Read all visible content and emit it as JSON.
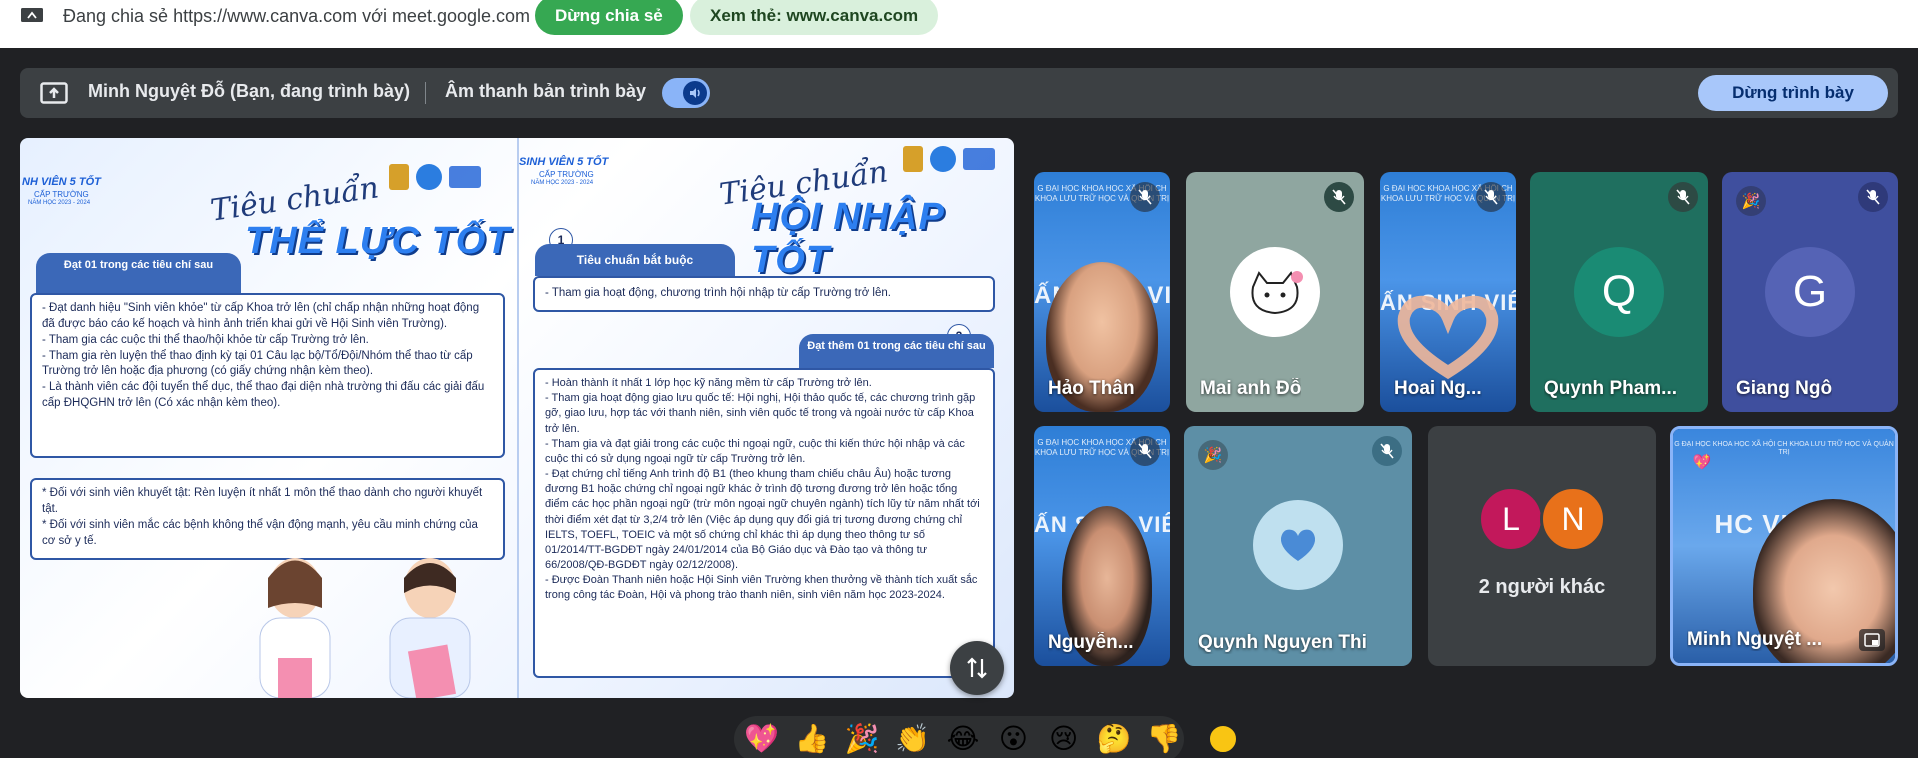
{
  "share_bar": {
    "text": "Đang chia sẻ https://www.canva.com với meet.google.com",
    "stop_share_label": "Dừng chia sẻ",
    "view_tab_label": "Xem thẻ: www.canva.com"
  },
  "presenter_bar": {
    "presenter": "Minh Nguyệt Đỗ (Bạn, đang trình bày)",
    "audio_label": "Âm thanh bản trình bày",
    "stop_present_label": "Dừng trình bày"
  },
  "slide": {
    "left": {
      "logo_line1": "NH VIÊN 5 TỐT",
      "logo_line2": "CẤP TRƯỜNG",
      "logo_line3": "NĂM HỌC 2023 - 2024",
      "script": "Tiêu chuẩn",
      "title": "THỂ LỰC TỐT",
      "tab": "Đạt 01 trong các tiêu chí sau",
      "box1": [
        "- Đạt danh hiệu \"Sinh viên khỏe\" từ cấp Khoa trở lên (chỉ chấp nhận những hoạt động đã được báo cáo kế hoạch và hình ảnh triển khai gửi về Hội Sinh viên Trường).",
        "- Tham gia các cuộc thi thể thao/hội khỏe từ cấp Trường trở lên.",
        "- Tham gia rèn luyện thể thao định kỳ tại 01 Câu lạc bộ/Tổ/Đội/Nhóm thể thao từ cấp Trường trở lên hoặc địa phương (có giấy chứng nhận kèm theo).",
        "- Là thành viên các đội tuyển thể dục, thể thao đại diện nhà trường thi đấu các giải đấu cấp ĐHQGHN trở lên (Có xác nhận kèm theo)."
      ],
      "box2": [
        "* Đối với sinh viên khuyết tật: Rèn luyện ít nhất 1 môn thể thao dành cho người khuyết tật.",
        "* Đối với sinh viên mắc các bệnh không thể vận động mạnh, yêu cầu minh chứng của cơ sở y tế."
      ]
    },
    "right": {
      "logo_line1": "SINH VIÊN 5 TỐT",
      "logo_line2": "CẤP TRƯỜNG",
      "logo_line3": "NĂM HỌC 2023 - 2024",
      "script": "Tiêu chuẩn",
      "title": "HỘI NHẬP TỐT",
      "num1": "1",
      "tab1": "Tiêu chuẩn bắt buộc",
      "mandatory": "- Tham gia hoạt động, chương trình hội nhập từ cấp Trường trở lên.",
      "num2": "2",
      "tab2": "Đạt thêm 01 trong các tiêu chí sau",
      "box": [
        "- Hoàn thành ít nhất 1 lớp học kỹ năng mềm từ cấp Trường trở lên.",
        "- Tham gia hoạt động giao lưu quốc tế: Hội nghị, Hội thảo quốc tế, các chương trình gặp gỡ, giao lưu, hợp tác với thanh niên, sinh viên quốc tế trong và ngoài nước từ cấp Khoa trở lên.",
        "- Tham gia và đạt giải trong các cuộc thi ngoại ngữ, cuộc thi kiến thức hội nhập và các cuộc thi có sử dụng ngoại ngữ từ cấp Trường trở lên.",
        "- Đạt chứng chỉ tiếng Anh trình độ B1 (theo khung tham chiếu châu Âu) hoặc tương đương B1 hoặc chứng chỉ ngoại ngữ khác ở trình độ tương đương trở lên hoặc tổng điểm các học phần ngoại ngữ (trừ môn ngoại ngữ chuyên ngành) tích lũy từ năm nhất tới thời điểm xét đạt từ 3,2/4 trở lên (Việc áp dụng quy đổi giá trị tương đương chứng chỉ IELTS, TOEFL, TOEIC và một số chứng chỉ khác thì áp dụng theo thông tư số 01/2014/TT-BGDĐT ngày 24/01/2014 của Bộ Giáo dục và Đào tạo và thông tư 66/2008/QĐ-BGDĐT ngày 02/12/2008).",
        "- Được Đoàn Thanh niên hoặc Hội Sinh viên Trường khen thưởng về thành tích xuất sắc trong công tác Đoàn, Hội và phong trào thanh niên, sinh viên năm học 2023-2024."
      ]
    }
  },
  "participants": [
    {
      "name": "Hảo Thân",
      "type": "video",
      "muted": true
    },
    {
      "name": "Mai anh Đỗ",
      "type": "avatar-image",
      "muted": true
    },
    {
      "name": "Hoai Ng...",
      "type": "video",
      "muted": true
    },
    {
      "name": "Quynh Pham...",
      "initial": "Q",
      "type": "initial",
      "muted": true,
      "tile_color": "#1f6f5f",
      "avatar_color": "#1a8b74"
    },
    {
      "name": "Giang Ngô",
      "initial": "G",
      "type": "initial",
      "muted": true,
      "tile_color": "#3f4f9e",
      "avatar_color": "#5563b5"
    },
    {
      "name": "Nguyễn...",
      "type": "video",
      "muted": true
    },
    {
      "name": "Quynh Nguyen Thi",
      "type": "heart-avatar",
      "muted": true
    },
    {
      "name": "2 người khác",
      "type": "others",
      "initials": [
        "L",
        "N"
      ],
      "colors": [
        "#c2185b",
        "#e8711a"
      ]
    },
    {
      "name": "Minh Nguyệt ...",
      "type": "video-self",
      "muted": false
    }
  ],
  "video_text": {
    "banner": "G ĐẠI HỌC KHOA HỌC XÃ HỘI CH KHOA LƯU TRỮ HỌC VÀ QUẢN TRỊ",
    "big1": "ẤN SINH VIÊ",
    "big2": "HC VIÊN S"
  },
  "reactions": [
    "💖",
    "👍",
    "🎉",
    "👏",
    "😂",
    "😮",
    "😢",
    "🤔",
    "👎"
  ],
  "colors": {
    "meet_bg": "#202124",
    "stop_share_green": "#36a852",
    "stop_present_blue": "#a8c7fa"
  }
}
